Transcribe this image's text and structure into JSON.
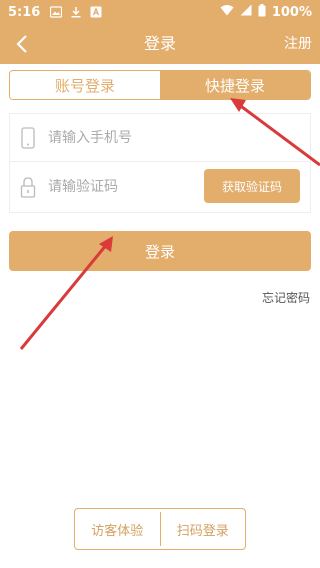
{
  "status_bar": {
    "time": "5:16",
    "battery": "100%"
  },
  "navbar": {
    "title": "登录",
    "register": "注册"
  },
  "tabs": [
    {
      "label": "账号登录",
      "active": false
    },
    {
      "label": "快捷登录",
      "active": true
    }
  ],
  "form": {
    "phone_placeholder": "请输入手机号",
    "code_placeholder": "请输验证码",
    "get_code_label": "获取验证码"
  },
  "login_button": "登录",
  "forgot_password": "忘记密码",
  "bottom_options": {
    "guest": "访客体验",
    "scan": "扫码登录"
  },
  "colors": {
    "primary": "#e3ad6c",
    "annotation": "#d93a3a"
  }
}
